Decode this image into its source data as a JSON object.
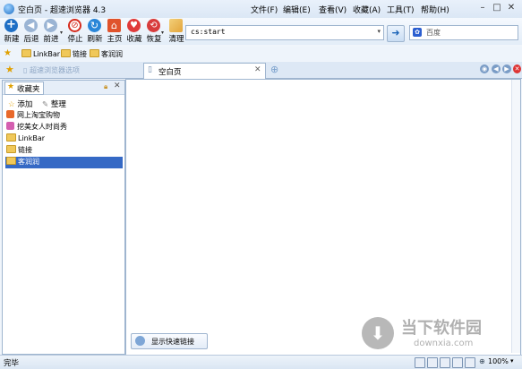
{
  "window": {
    "title": "空白页 - 超速浏览器 4.3",
    "menu": [
      "文件(F)",
      "编辑(E)",
      "查看(V)",
      "收藏(A)",
      "工具(T)",
      "帮助(H)"
    ]
  },
  "toolbar": {
    "buttons": [
      {
        "label": "新建",
        "icon": "plus-icon",
        "color": "#1f6fc5"
      },
      {
        "label": "后退",
        "icon": "back-arrow-icon",
        "color": "#9ab4d4"
      },
      {
        "label": "前进",
        "icon": "forward-arrow-icon",
        "color": "#9ab4d4"
      },
      {
        "label": "停止",
        "icon": "stop-icon",
        "color": "#d62c1e"
      },
      {
        "label": "刷新",
        "icon": "refresh-icon",
        "color": "#2a86d8"
      },
      {
        "label": "主页",
        "icon": "home-icon",
        "color": "#e0532c"
      },
      {
        "label": "收藏",
        "icon": "favorite-heart-icon",
        "color": "#e03a3a"
      },
      {
        "label": "恢复",
        "icon": "restore-icon",
        "color": "#d83c3c"
      },
      {
        "label": "清理",
        "icon": "broom-icon",
        "color": "#e3a43a"
      }
    ],
    "address": "cs:start",
    "search_placeholder": "百度"
  },
  "favbar": {
    "items": [
      "LinkBar",
      "链接",
      "客润润"
    ]
  },
  "tabs": {
    "pane_tab_label": "超速浏览器选项",
    "active_tab_label": "空白页"
  },
  "sidebar": {
    "title": "收藏夹",
    "add_label": "添加",
    "organize_label": "整理",
    "items": [
      {
        "label": "网上淘宝购物",
        "icon": "taobao-icon",
        "selected": false
      },
      {
        "label": "挖美女人时尚秀",
        "icon": "fashion-icon",
        "selected": false
      },
      {
        "label": "LinkBar",
        "icon": "folder-icon",
        "selected": false
      },
      {
        "label": "链接",
        "icon": "folder-icon",
        "selected": false
      },
      {
        "label": "客润润",
        "icon": "folder-icon",
        "selected": true
      }
    ]
  },
  "main": {
    "quick_link_button": "显示快速链接"
  },
  "watermark": {
    "cn": "当下软件园",
    "en": "downxia.com"
  },
  "statusbar": {
    "text": "完毕",
    "zoom": "100%"
  }
}
